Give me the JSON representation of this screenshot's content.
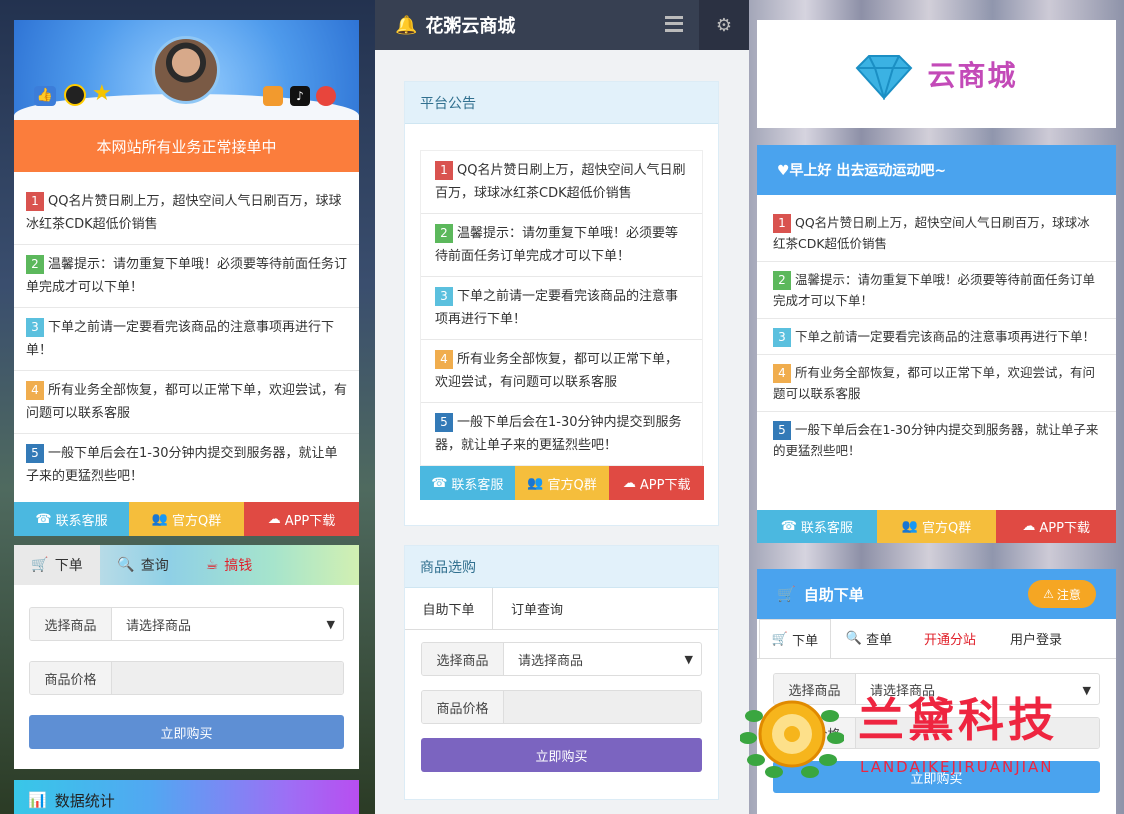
{
  "notices": [
    {
      "num": "1",
      "text": "QQ名片赞日刷上万，超快空间人气日刷百万，球球冰红茶CDK超低价销售"
    },
    {
      "num": "2",
      "text": "温馨提示：请勿重复下单哦！必须要等待前面任务订单完成才可以下单！"
    },
    {
      "num": "3",
      "text": "下单之前请一定要看完该商品的注意事项再进行下单！"
    },
    {
      "num": "4",
      "text": "所有业务全部恢复，都可以正常下单，欢迎尝试，有问题可以联系客服"
    },
    {
      "num": "5",
      "text": "一般下单后会在1-30分钟内提交到服务器，就让单子来的更猛烈些吧！"
    }
  ],
  "contact_btns": {
    "service": "联系客服",
    "qq_group": "官方Q群",
    "app": "APP下载"
  },
  "left": {
    "banner": "本网站所有业务正常接单中",
    "tabs": {
      "order": "下单",
      "query": "查询",
      "earn": "搞钱"
    },
    "select_label": "选择商品",
    "select_value": "请选择商品",
    "price_label": "商品价格",
    "buy_button": "立即购买",
    "stats_title": "数据统计"
  },
  "mid": {
    "site_title": "花粥云商城",
    "notice_title": "平台公告",
    "shop_title": "商品选购",
    "tab_self": "自助下单",
    "tab_query": "订单查询",
    "select_label": "选择商品",
    "select_value": "请选择商品",
    "price_label": "商品价格",
    "buy_button": "立即购买"
  },
  "right": {
    "logo_text": "云商城",
    "greeting": "♥早上好 出去运动运动吧~",
    "self_order_title": "自助下单",
    "attention_button": "注意",
    "tabs": {
      "order": "下单",
      "query": "查单",
      "branch": "开通分站",
      "login": "用户登录"
    },
    "select_label": "选择商品",
    "select_value": "请选择商品",
    "price_label": "商品价格",
    "buy_button": "立即购买"
  },
  "watermark": {
    "cn": "兰黛科技",
    "en": "LANDAIKEJIRUANJIAN"
  },
  "colors": {
    "orange": "#fb7d3c",
    "purple_btn": "#7b64c0",
    "blue_btn": "#5e8fd4",
    "right_header": "#4aa3ee"
  }
}
